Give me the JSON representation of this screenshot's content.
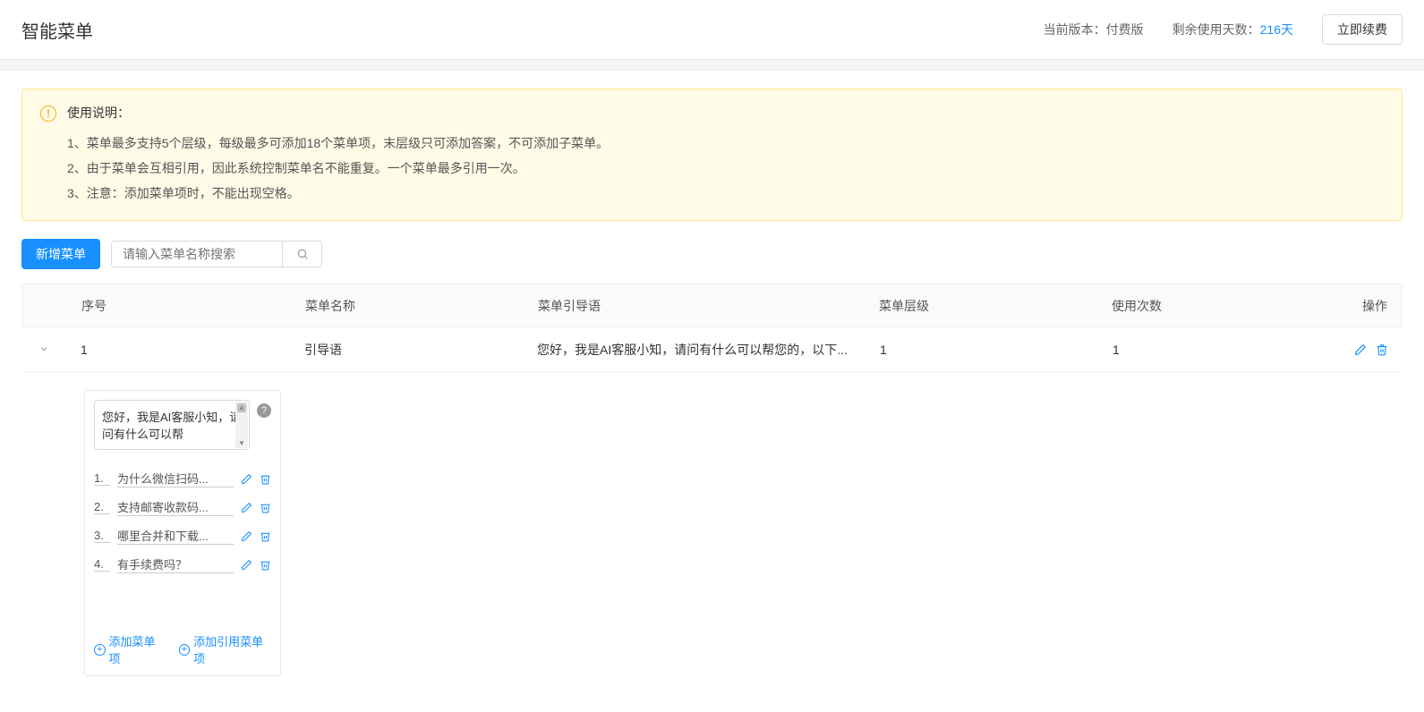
{
  "header": {
    "title": "智能菜单",
    "version_label": "当前版本：",
    "version_value": "付费版",
    "days_label": "剩余使用天数：",
    "days_value": "216天",
    "renew_btn": "立即续费"
  },
  "alert": {
    "title": "使用说明：",
    "lines": [
      "1、菜单最多支持5个层级，每级最多可添加18个菜单项，末层级只可添加答案，不可添加子菜单。",
      "2、由于菜单会互相引用，因此系统控制菜单名不能重复。一个菜单最多引用一次。",
      "3、注意：添加菜单项时，不能出现空格。"
    ]
  },
  "toolbar": {
    "new_btn": "新增菜单",
    "search_placeholder": "请输入菜单名称搜索"
  },
  "table": {
    "headers": {
      "seq": "序号",
      "name": "菜单名称",
      "guide": "菜单引导语",
      "level": "菜单层级",
      "usage": "使用次数",
      "action": "操作"
    },
    "rows": [
      {
        "seq": "1",
        "name": "引导语",
        "guide": "您好，我是AI客服小知，请问有什么可以帮您的，以下...",
        "level": "1",
        "usage": "1"
      }
    ]
  },
  "detail": {
    "guide_text": "您好，我是AI客服小知，请问有什么可以帮",
    "items": [
      {
        "num": "1.",
        "label": "为什么微信扫码..."
      },
      {
        "num": "2.",
        "label": "支持邮寄收款码..."
      },
      {
        "num": "3.",
        "label": "哪里合并和下载..."
      },
      {
        "num": "4.",
        "label": "有手续费吗？"
      }
    ],
    "add_item": "添加菜单项",
    "add_ref": "添加引用菜单项"
  }
}
